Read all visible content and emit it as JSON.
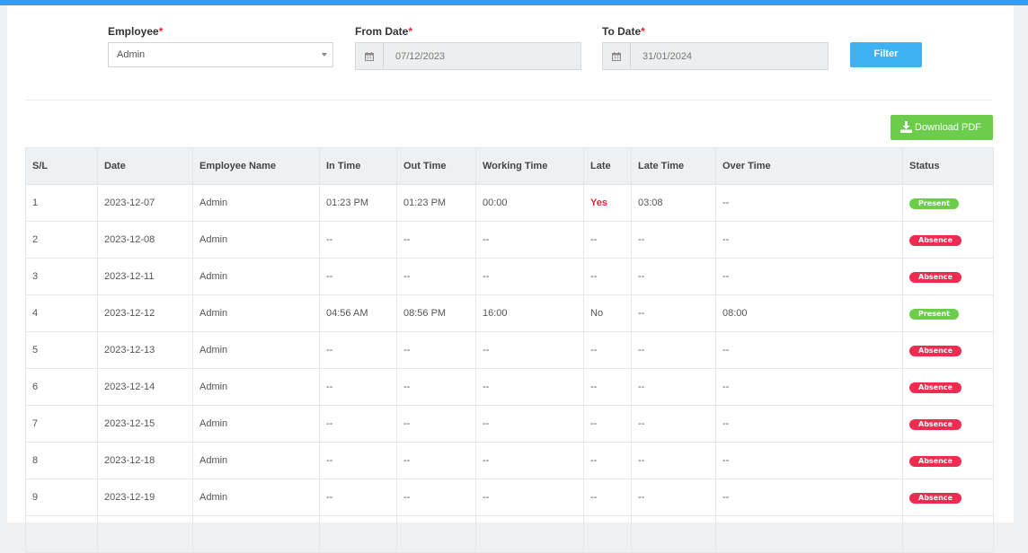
{
  "filters": {
    "employee": {
      "label": "Employee",
      "required_mark": "*",
      "value": "Admin"
    },
    "from_date": {
      "label": "From Date",
      "required_mark": "*",
      "value": "07/12/2023"
    },
    "to_date": {
      "label": "To Date",
      "required_mark": "*",
      "value": "31/01/2024"
    },
    "filter_button": "Filter"
  },
  "download_button": "Download PDF",
  "colors": {
    "top_bar": "#3d9be9",
    "present": "#6ccc4b",
    "absence": "#ec2d50",
    "late_yes": "#e8233f",
    "filter_button": "#3fb2f3"
  },
  "table": {
    "headers": [
      "S/L",
      "Date",
      "Employee Name",
      "In Time",
      "Out Time",
      "Working Time",
      "Late",
      "Late Time",
      "Over Time",
      "Status"
    ],
    "rows": [
      [
        "1",
        "2023-12-07",
        "Admin",
        "01:23 PM",
        "01:23 PM",
        "00:00",
        "Yes",
        "03:08",
        "--",
        "Present"
      ],
      [
        "2",
        "2023-12-08",
        "Admin",
        "--",
        "--",
        "--",
        "--",
        "--",
        "--",
        "Absence"
      ],
      [
        "3",
        "2023-12-11",
        "Admin",
        "--",
        "--",
        "--",
        "--",
        "--",
        "--",
        "Absence"
      ],
      [
        "4",
        "2023-12-12",
        "Admin",
        "04:56 AM",
        "08:56 PM",
        "16:00",
        "No",
        "--",
        "08:00",
        "Present"
      ],
      [
        "5",
        "2023-12-13",
        "Admin",
        "--",
        "--",
        "--",
        "--",
        "--",
        "--",
        "Absence"
      ],
      [
        "6",
        "2023-12-14",
        "Admin",
        "--",
        "--",
        "--",
        "--",
        "--",
        "--",
        "Absence"
      ],
      [
        "7",
        "2023-12-15",
        "Admin",
        "--",
        "--",
        "--",
        "--",
        "--",
        "--",
        "Absence"
      ],
      [
        "8",
        "2023-12-18",
        "Admin",
        "--",
        "--",
        "--",
        "--",
        "--",
        "--",
        "Absence"
      ],
      [
        "9",
        "2023-12-19",
        "Admin",
        "--",
        "--",
        "--",
        "--",
        "--",
        "--",
        "Absence"
      ],
      [
        "",
        "",
        "",
        "",
        "",
        "",
        "",
        "",
        "",
        ""
      ]
    ]
  }
}
